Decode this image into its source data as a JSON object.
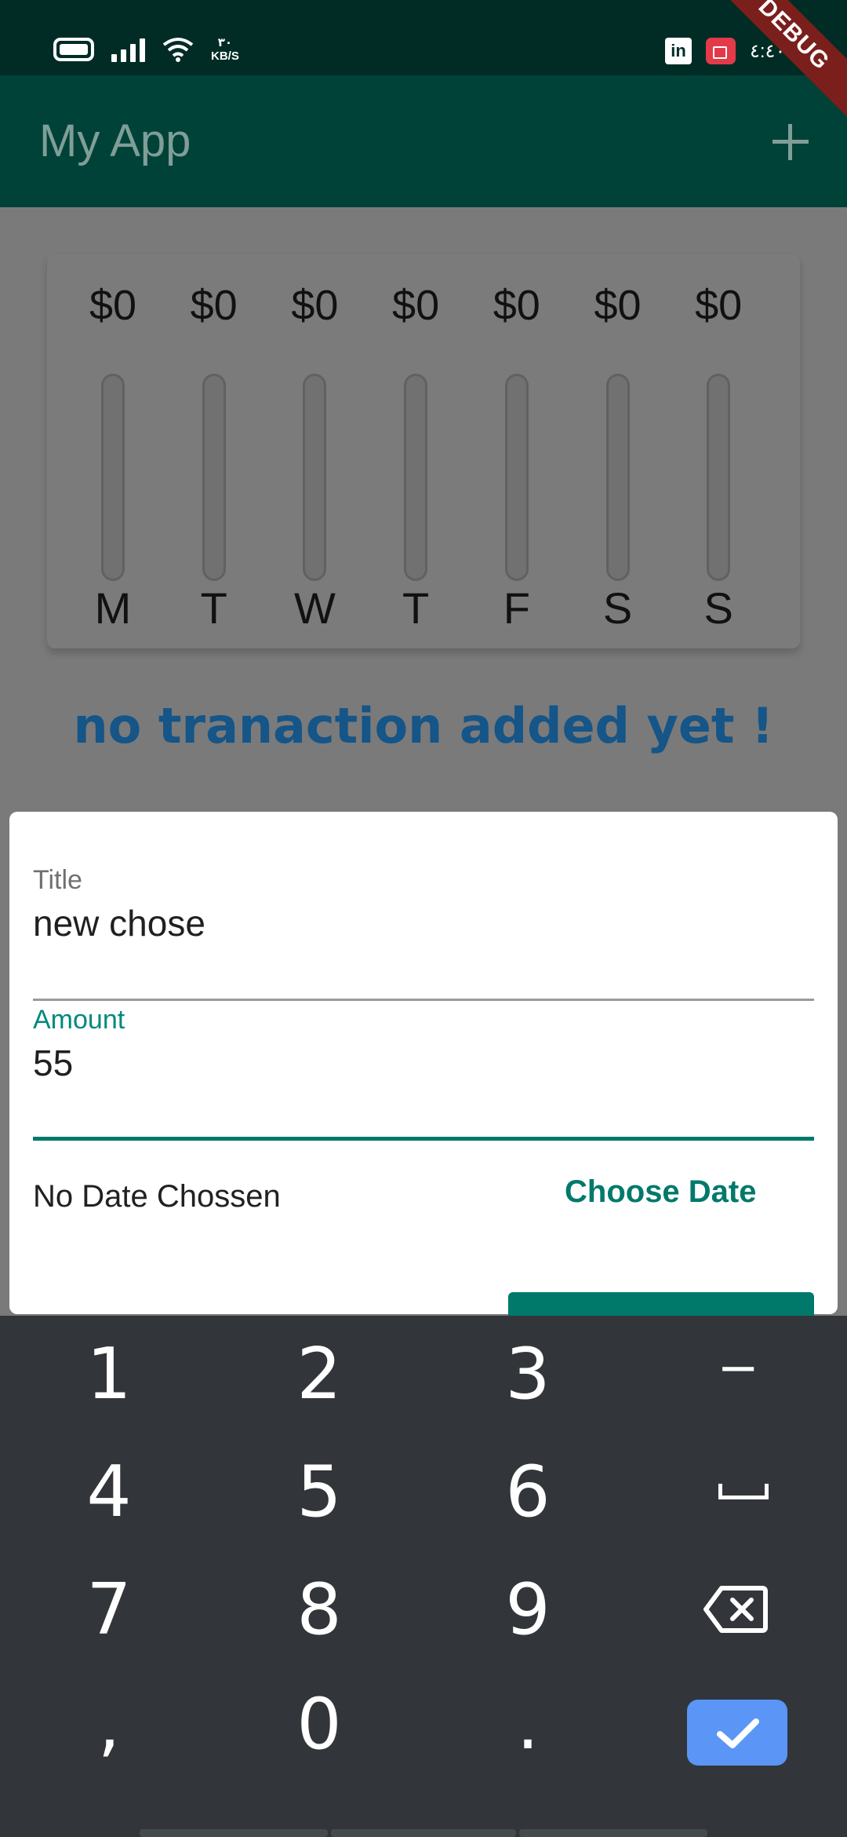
{
  "status_bar": {
    "net_speed_value": "٣٠",
    "net_speed_unit": "KB/S",
    "clock": "٤:٤٠"
  },
  "app_bar": {
    "title": "My App",
    "debug_banner": "DEBUG",
    "add_icon": "plus-icon"
  },
  "chart": {
    "bars": [
      {
        "amount": "$0",
        "day": "M",
        "fill": 0
      },
      {
        "amount": "$0",
        "day": "T",
        "fill": 0
      },
      {
        "amount": "$0",
        "day": "W",
        "fill": 0
      },
      {
        "amount": "$0",
        "day": "T",
        "fill": 0
      },
      {
        "amount": "$0",
        "day": "F",
        "fill": 0
      },
      {
        "amount": "$0",
        "day": "S",
        "fill": 0
      },
      {
        "amount": "$0",
        "day": "S",
        "fill": 0
      }
    ]
  },
  "empty_message": "no tranaction added yet !",
  "form": {
    "title_label": "Title",
    "title_value": "new chose",
    "amount_label": "Amount",
    "amount_value": "55",
    "date_text": "No Date Chossen",
    "choose_date_label": "Choose Date"
  },
  "keyboard": {
    "keys": [
      "1",
      "2",
      "3",
      "−",
      "4",
      "5",
      "6",
      "space",
      "7",
      "8",
      "9",
      "backspace",
      ",",
      "0",
      ".",
      "done"
    ]
  },
  "colors": {
    "primary": "#004237",
    "accent": "#00796b",
    "keyboard_bg": "#32363a",
    "done_key": "#5b95f5"
  }
}
